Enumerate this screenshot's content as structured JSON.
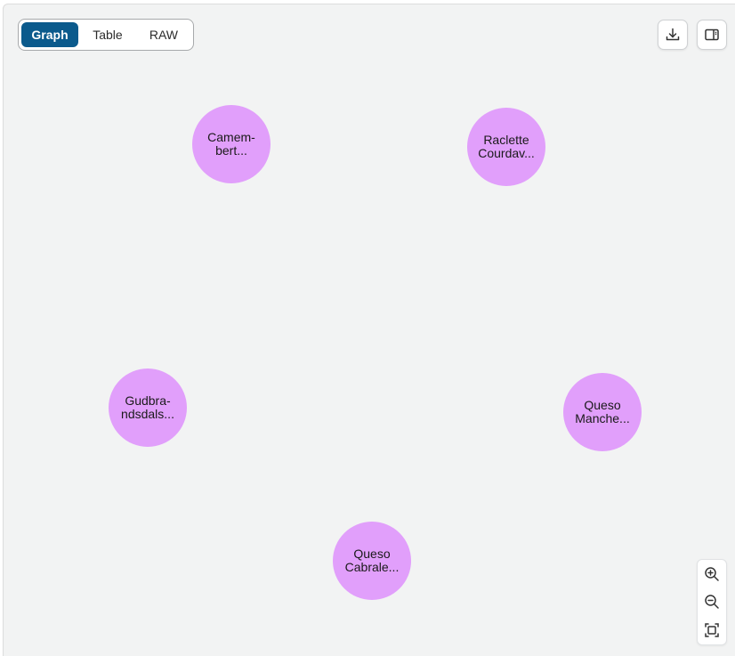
{
  "tabs": [
    {
      "label": "Graph",
      "active": true
    },
    {
      "label": "Table",
      "active": false
    },
    {
      "label": "RAW",
      "active": false
    }
  ],
  "toolbar": {
    "download_icon": "download-icon",
    "panel_icon": "side-panel-icon"
  },
  "zoom": {
    "zoom_in_icon": "zoom-in-icon",
    "zoom_out_icon": "zoom-out-icon",
    "fit_icon": "fit-to-screen-icon"
  },
  "colors": {
    "node_fill": "#e19ffb",
    "active_tab": "#0b5a8c",
    "canvas_bg": "#f2f3f3"
  },
  "nodes": [
    {
      "line1": "Camem-",
      "line2": "bert..."
    },
    {
      "line1": "Raclette",
      "line2": "Courdav..."
    },
    {
      "line1": "Gudbra-",
      "line2": "ndsdals..."
    },
    {
      "line1": "Queso",
      "line2": "Manche..."
    },
    {
      "line1": "Queso",
      "line2": "Cabrale..."
    }
  ]
}
